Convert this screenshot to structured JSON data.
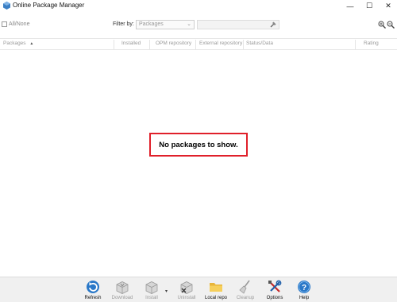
{
  "window": {
    "title": "Online Package Manager",
    "min_glyph": "—",
    "max_glyph": "☐",
    "close_glyph": "✕"
  },
  "filter": {
    "all_none_label": "All/None",
    "filter_by_label": "Filter by:",
    "selected": "Packages",
    "search_value": ""
  },
  "columns": [
    "Packages",
    "Installed",
    "OPM repository",
    "External repository",
    "Status/Data",
    "Rating"
  ],
  "sort_glyph": "▲",
  "empty_message": "No packages to show.",
  "toolbar": [
    {
      "label": "Refresh",
      "icon": "refresh-icon",
      "enabled": true
    },
    {
      "label": "Download",
      "icon": "download-icon",
      "enabled": false
    },
    {
      "label": "Install",
      "icon": "install-icon",
      "enabled": false
    },
    {
      "label": "Uninstall",
      "icon": "uninstall-icon",
      "enabled": false
    },
    {
      "label": "Local repo",
      "icon": "folder-icon",
      "enabled": true
    },
    {
      "label": "Cleanup",
      "icon": "broom-icon",
      "enabled": false
    },
    {
      "label": "Options",
      "icon": "tools-icon",
      "enabled": true
    },
    {
      "label": "Help",
      "icon": "help-icon",
      "enabled": true
    }
  ],
  "colors": {
    "highlight_border": "#e0202a",
    "accent_blue": "#2a78c8"
  }
}
